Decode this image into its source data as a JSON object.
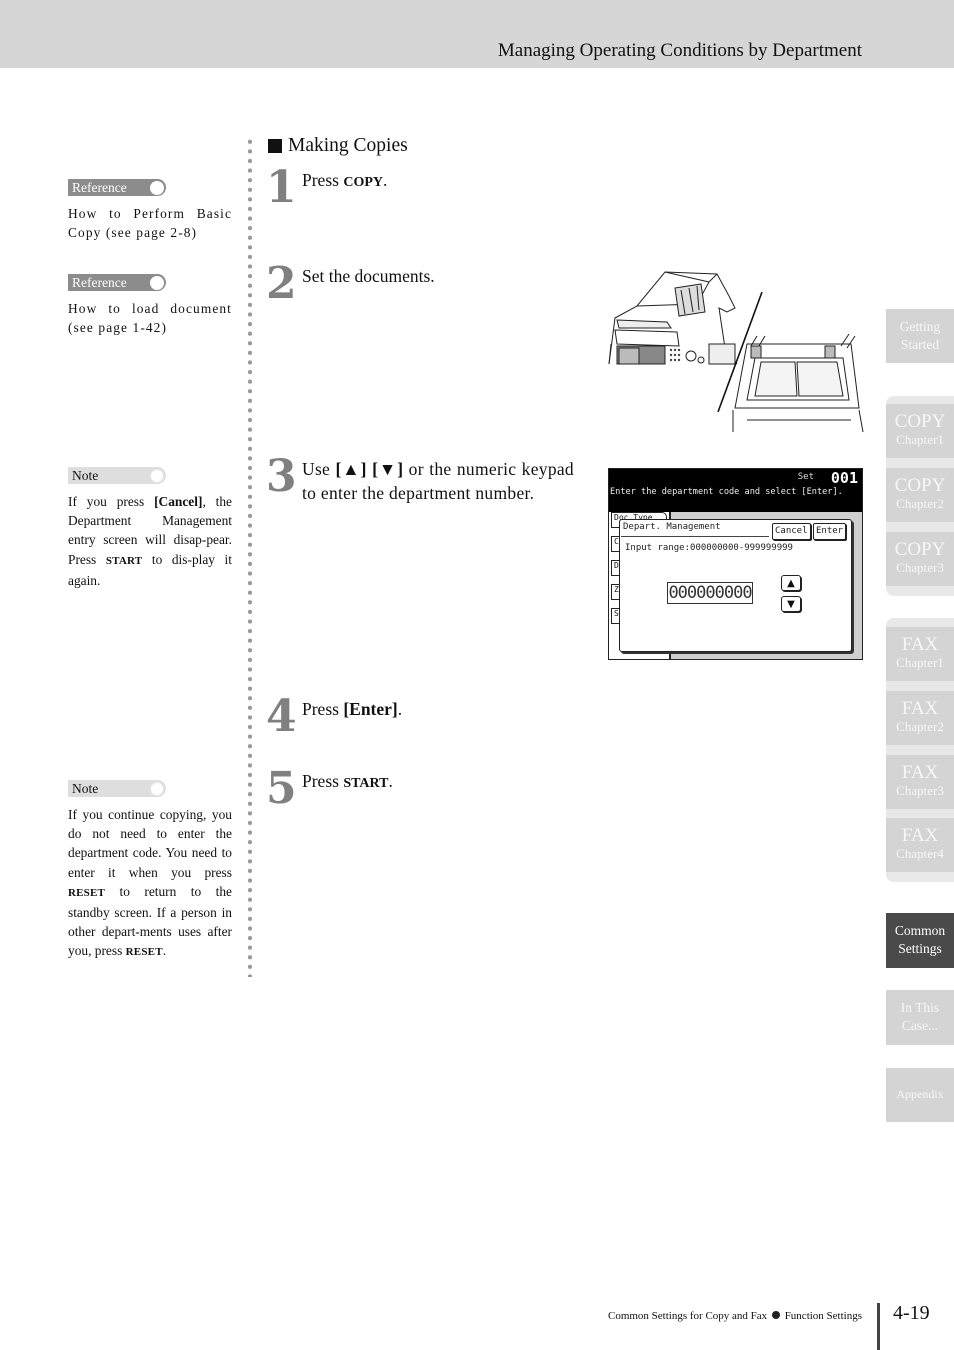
{
  "header": {
    "title": "Managing Operating Conditions by Department"
  },
  "sidebar_notes": [
    {
      "type": "Reference",
      "text": "How to Perform Basic Copy (see page 2-8)"
    },
    {
      "type": "Reference",
      "text": "How to load document (see page 1-42)"
    },
    {
      "type": "Note",
      "text_parts": [
        "If you press ",
        "[Cancel]",
        ", the Department Management entry screen will disap-pear. Press ",
        "START",
        " to dis-play it again."
      ]
    },
    {
      "type": "Note",
      "text_parts": [
        "If you continue copying, you do not need to enter the department code. You need to enter it when you press ",
        "RESET",
        " to return to the standby screen. If a person in other depart-ments uses after you, press ",
        "RESET",
        "."
      ]
    }
  ],
  "section": {
    "heading": "Making Copies"
  },
  "steps": [
    {
      "number": "1",
      "parts": [
        "Press ",
        "COPY",
        "."
      ]
    },
    {
      "number": "2",
      "text": "Set the documents."
    },
    {
      "number": "3",
      "parts": [
        "Use ",
        "[▲] [▼]",
        " or the numeric keypad to enter the department number."
      ]
    },
    {
      "number": "4",
      "parts": [
        "Press ",
        "[Enter]",
        "."
      ]
    },
    {
      "number": "5",
      "parts": [
        "Press ",
        "START",
        "."
      ]
    }
  ],
  "illustration": {
    "label": "copier-document-placement"
  },
  "lcd_screen": {
    "set_label": "Set",
    "copy_count": "001",
    "message": "Enter the department code and select [Enter].",
    "left_tabs": [
      "Doc.Type",
      "Co",
      "Du",
      "Zo",
      "So"
    ],
    "dialog": {
      "title": "Depart. Management",
      "cancel_label": "Cancel",
      "enter_label": "Enter",
      "input_range": "Input range:000000000-999999999",
      "value": "000000000",
      "up_arrow": "▲",
      "down_arrow": "▼"
    }
  },
  "chapter_tabs": [
    {
      "line1": "Getting",
      "line2": "Started",
      "active": false
    },
    {
      "big": "COPY",
      "small": "Chapter1",
      "active": false
    },
    {
      "big": "COPY",
      "small": "Chapter2",
      "active": false
    },
    {
      "big": "COPY",
      "small": "Chapter3",
      "active": false
    },
    {
      "big": "FAX",
      "small": "Chapter1",
      "active": false
    },
    {
      "big": "FAX",
      "small": "Chapter2",
      "active": false
    },
    {
      "big": "FAX",
      "small": "Chapter3",
      "active": false
    },
    {
      "big": "FAX",
      "small": "Chapter4",
      "active": false
    },
    {
      "line1": "Common",
      "line2": "Settings",
      "active": true
    },
    {
      "line1": "In This",
      "line2": "Case...",
      "active": false
    },
    {
      "line1": "Appendix",
      "active": false
    }
  ],
  "footer": {
    "left_text": "Common Settings for Copy and Fax",
    "right_text": "Function Settings",
    "page_number": "4-19"
  }
}
